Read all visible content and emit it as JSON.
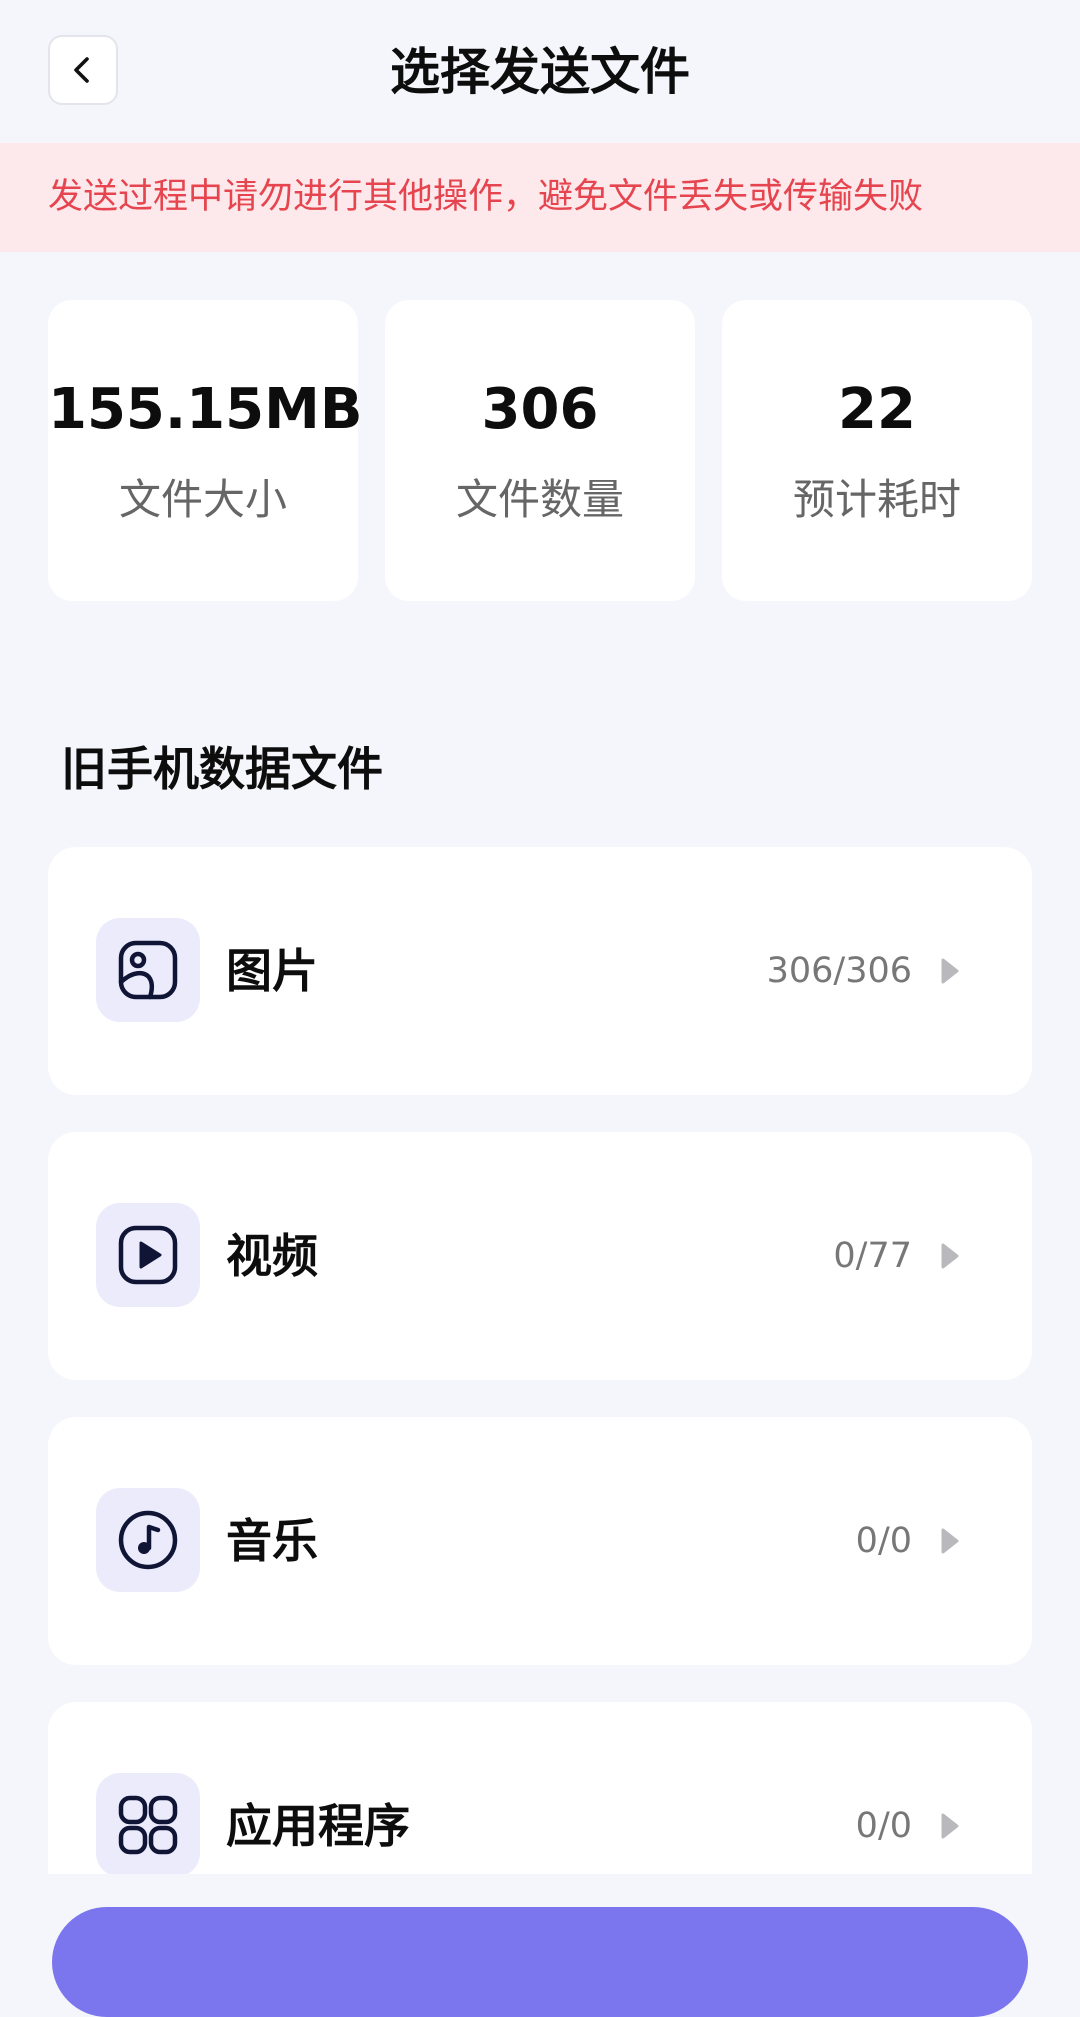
{
  "header": {
    "title": "选择发送文件"
  },
  "warning": {
    "text": "发送过程中请勿进行其他操作，避免文件丢失或传输失败"
  },
  "stats": [
    {
      "value": "155.15MB",
      "label": "文件大小"
    },
    {
      "value": "306",
      "label": "文件数量"
    },
    {
      "value": "22",
      "label": "预计耗时"
    }
  ],
  "section": {
    "title": "旧手机数据文件"
  },
  "categories": [
    {
      "label": "图片",
      "count": "306/306",
      "icon": "image-icon"
    },
    {
      "label": "视频",
      "count": "0/77",
      "icon": "video-icon"
    },
    {
      "label": "音乐",
      "count": "0/0",
      "icon": "music-icon"
    },
    {
      "label": "应用程序",
      "count": "0/0",
      "icon": "apps-icon"
    }
  ],
  "colors": {
    "background": "#f5f6fb",
    "warning_bg": "#fde9ec",
    "warning_text": "#e6454f",
    "icon_bg": "#ebebfc",
    "icon_stroke": "#101535",
    "primary_button": "#7b76ee"
  }
}
